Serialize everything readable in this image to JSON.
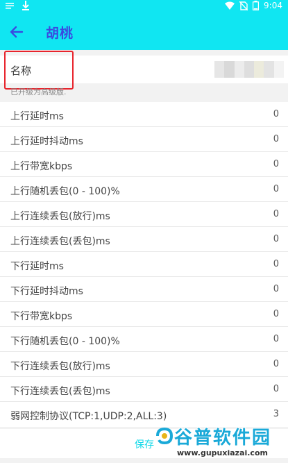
{
  "status_bar": {
    "time": "9:04",
    "battery_level": "8",
    "icons": [
      "notification-icon",
      "download-icon",
      "wifi-icon",
      "no-sim-icon",
      "battery-icon"
    ]
  },
  "toolbar": {
    "title": "胡桃",
    "back_icon": "arrow-left-icon"
  },
  "name_row": {
    "label": "名称"
  },
  "hint": "已开级为高级版.",
  "params": [
    {
      "label": "上行延时ms",
      "value": "0"
    },
    {
      "label": "上行延时抖动ms",
      "value": "0"
    },
    {
      "label": "上行带宽kbps",
      "value": "0"
    },
    {
      "label": "上行随机丢包(0 - 100)%",
      "value": "0"
    },
    {
      "label": "上行连续丢包(放行)ms",
      "value": "0"
    },
    {
      "label": "上行连续丢包(丢包)ms",
      "value": "0"
    },
    {
      "label": "下行延时ms",
      "value": "0"
    },
    {
      "label": "下行延时抖动ms",
      "value": "0"
    },
    {
      "label": "下行带宽kbps",
      "value": "0"
    },
    {
      "label": "下行随机丢包(0 - 100)%",
      "value": "0"
    },
    {
      "label": "下行连续丢包(放行)ms",
      "value": "0"
    },
    {
      "label": "下行连续丢包(丢包)ms",
      "value": "0"
    },
    {
      "label": "弱网控制协议(TCP:1,UDP:2,ALL:3)",
      "value": "3"
    }
  ],
  "save_label": "保存",
  "watermark": {
    "title": "谷普软件园",
    "url": "www.gupuxiazai.com"
  },
  "colors": {
    "accent": "#10e6f2",
    "title": "#3a4ae0",
    "highlight": "#e8242c"
  }
}
